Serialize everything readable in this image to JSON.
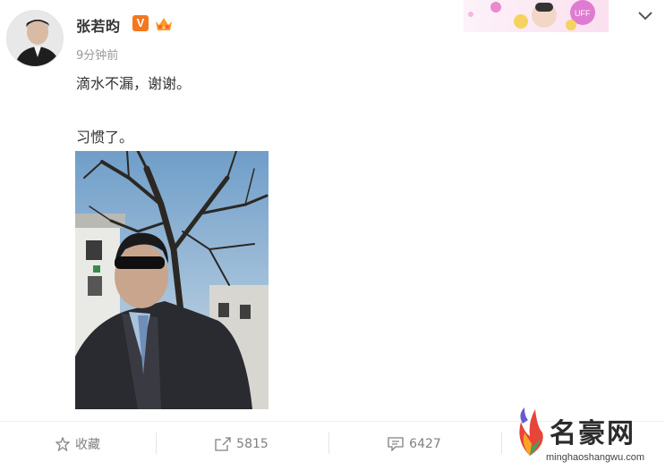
{
  "post": {
    "username": "张若昀",
    "verified_badge": "V",
    "timestamp": "9分钟前",
    "text_line1": "滴水不漏，谢谢。",
    "text_line2": "习惯了。"
  },
  "icons": {
    "verified": "verified-v-icon",
    "member": "crown-icon",
    "menu": "chevron-down-icon",
    "favorite": "star-icon",
    "repost": "share-icon",
    "comment": "comment-icon"
  },
  "actions": {
    "favorite_label": "收藏",
    "repost_count": "5815",
    "comment_count": "6427"
  },
  "watermark": {
    "title": "名豪网",
    "url": "minghaoshangwu.com"
  },
  "colors": {
    "vip_orange": "#f3781f",
    "text_primary": "#333333",
    "text_secondary": "#999999"
  }
}
